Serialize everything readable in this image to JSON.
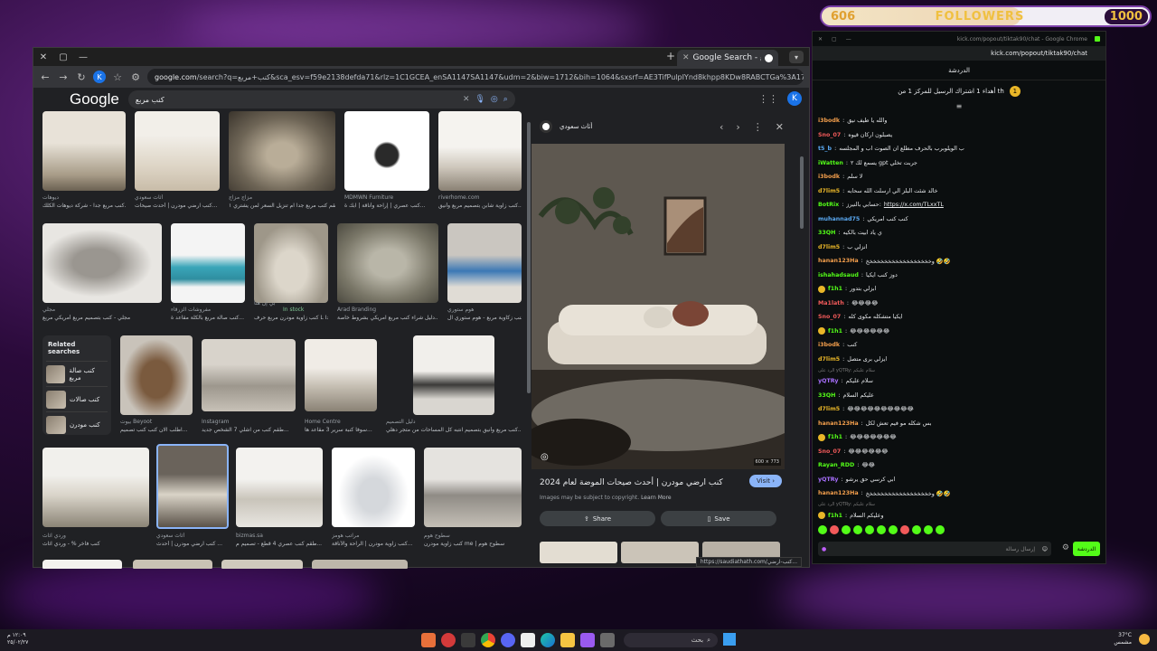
{
  "overlay": {
    "current_count": "606",
    "label": "FOLLOWERS",
    "goal": "1000",
    "progress_fraction": 0.606
  },
  "browser": {
    "tab_title": "Google Search - كنب مربع",
    "url_host": "google.com",
    "url_rest": "/search?q=كنب+مربع&sca_esv=f59e2138defda71&rlz=1C1GCEA_enSA1147SA1147&udm=2&biw=1712&bih=1064&sxsrf=AE3TifPulpIYnd8khpp8KDw8RABCTGa%3A1755712065658&ei=RfGmaK31J_qckdUP",
    "search_query": "كنب مربع",
    "avatar_letter": "K",
    "logo": "Google",
    "status_url": "https://saudiathath.com/كنب-ارضي..."
  },
  "results": {
    "row1": [
      {
        "source": "ديوهات",
        "title": "كنب مربع جدا - شركة ديوهات الكلك..."
      },
      {
        "source": "أثاث سعودي",
        "title": "كنب ارضي مودرن | أحدث صيحات..."
      },
      {
        "source": "مزاج مزاج",
        "title": "طقم كنب مربع جدا ام تنزيل السعر لمن يشتري ١..."
      },
      {
        "source": "MDMWN Furniture",
        "title": "كنب عصري | إراحة وأناقة | ابك ة..."
      },
      {
        "source": "riverhome.com",
        "title": "كنب زاوية شابن بتصميم مربع وأنيق..."
      }
    ],
    "row2": [
      {
        "source": "مجلي",
        "title": "مجلي - كنب بتصميم مربع أمريكي مربع"
      },
      {
        "source": "مفروشات الزرقاء",
        "title": "كنب صالة مربع بالكلة مقاعد ة..."
      },
      {
        "source": "بي إن هنا",
        "title": "كنب زاوية مودرن مربع حرف L جدا...",
        "stock": "In stock"
      },
      {
        "source": "Arad Branding",
        "title": "دليل شراء كنب مربع امريكي بشروط خاصة..."
      },
      {
        "source": "هوم ستوري",
        "title": "كنب زكاوية مربع - هوم ستوري ال..."
      }
    ],
    "related": {
      "heading": "Related searches",
      "items": [
        "كنب صالة مربع",
        "كنب صالات",
        "كنب مودرن"
      ]
    },
    "row3": [
      {
        "source": "بيوت Beyoot",
        "title": "اطلب الان كنب كنب تصميم..."
      },
      {
        "source": "Instagram",
        "title": "طقم كنب من آشلي 7 الشخص جديد..."
      },
      {
        "source": "Home Centre",
        "title": "سوفا كنبة سرير 3 مقاعد ها..."
      },
      {
        "source": "دليل التصميم",
        "title": "كنب مربع وأنيق بتصميم انتبه كل المساحات من متجر دهلي..."
      }
    ],
    "row4": [
      {
        "source": "وردي اثاث",
        "title": "كنب فاخر % - وردي اثاث"
      },
      {
        "source": "أثاث سعودي",
        "title": "كنب ارضي مودرن | أحدث ..."
      },
      {
        "source": "bizmas.sa",
        "title": "طقم كنب عصري 4 قطع - تصميم م..."
      },
      {
        "source": "مراتب هومز",
        "title": "كنب زاوية مودرن | الراحة والأناقة..."
      },
      {
        "source": "سطوح هوم",
        "title": "كنب زاوية مودرن me | سطوح هوم"
      }
    ]
  },
  "preview": {
    "source_name": "أثاث سعودي",
    "title": "كنب ارضي مودرن | أحدث صيحات الموضة لعام 2024",
    "visit_label": "Visit",
    "copyright": "Images may be subject to copyright.",
    "learn_more": "Learn More",
    "share_label": "Share",
    "save_label": "Save",
    "size": "600 × 773"
  },
  "chat": {
    "window_title": "kick.com/popout/tiktak90/chat - Google Chrome",
    "url": "kick.com/popout/tiktak90/chat",
    "header": "الدردشة",
    "pinned": "أهداء 1 اشتراك الرسيل للمركز 1 من th",
    "pinned_num": "1",
    "messages": [
      {
        "user": "i3bodk",
        "color": "#f29e4c",
        "text": "والله يا طيف نيق"
      },
      {
        "user": "Sno_07",
        "color": "#f25a5a",
        "text": "يصبلون اركان قيوه"
      },
      {
        "user": "t5_b",
        "color": "#5aa9f2",
        "text": "ب الويلوبرب بالحرف مطلع ان الصوت اب و المجلسه"
      },
      {
        "user": "iWatten",
        "color": "#53fc18",
        "text": "يسمع لك ٢ gpt جربت تخلي"
      },
      {
        "user": "i3bodk",
        "color": "#f29e4c",
        "text": "لا سلم"
      },
      {
        "user": "d7lim5",
        "color": "#e9b628",
        "text": "خالد شئت البلز الي ارسلت الله سحابه"
      },
      {
        "user": "BotRix",
        "color": "#53fc18",
        "text": "حسابي بالنيرز:",
        "link": "https://x.com/TLxxTL"
      },
      {
        "user": "muhannad75",
        "color": "#5aa9f2",
        "text": "كنب كنب امريكي"
      },
      {
        "user": "33QH",
        "color": "#53fc18",
        "text": "ي ياد ابيت بالكيه"
      },
      {
        "user": "d7lim5",
        "color": "#e9b628",
        "text": "انزلي ب"
      },
      {
        "user": "hanan123Ha",
        "color": "#f29e4c",
        "text": "وخخخخخخخخخخخخخخخخخخ 🤣🤣"
      },
      {
        "user": "ishahadsaud",
        "color": "#53fc18",
        "text": "دوز كنب ايكيا"
      },
      {
        "user": "f1h1",
        "color": "#53fc18",
        "text": "ابزلي بتدور"
      },
      {
        "user": "Ma1lath",
        "color": "#f25a5a",
        "text": "😂😂😂😂"
      },
      {
        "user": "Sno_07",
        "color": "#f25a5a",
        "text": "ايكيا متشكله مكوى كله"
      },
      {
        "user": "f1h1",
        "color": "#53fc18",
        "text": "😂😂😂😂😂😂"
      },
      {
        "user": "i3bodk",
        "color": "#f29e4c",
        "text": "كنب"
      },
      {
        "user": "d7lim5",
        "color": "#e9b628",
        "text": "ايزلي برى متصل"
      },
      {
        "user": "yQTRy",
        "color": "#a970ff",
        "text": "سلام عليكم",
        "reply": "الرد على yQTRy: سلام عليكم"
      },
      {
        "user": "33QH",
        "color": "#53fc18",
        "text": "عليكم السلام"
      },
      {
        "user": "d7lim5",
        "color": "#e9b628",
        "text": "😂😂😂😂😂😂😂😂😂😂"
      },
      {
        "user": "hanan123Ha",
        "color": "#f29e4c",
        "text": "بس شكله مو فيم تعش لكل"
      },
      {
        "user": "f1h1",
        "color": "#53fc18",
        "text": "😂😂😂😂😂😂😂"
      },
      {
        "user": "Sno_07",
        "color": "#f25a5a",
        "text": "😂😂😂😂😂😂"
      },
      {
        "user": "Rayan_RDD",
        "color": "#53fc18",
        "text": "😂😂"
      },
      {
        "user": "yQTRy",
        "color": "#a970ff",
        "text": "ابي كرسي حق يرشو"
      },
      {
        "user": "hanan123Ha",
        "color": "#f29e4c",
        "text": "وخخخخخخخخخخخخخخخخخخ 🤣🤣"
      },
      {
        "user": "f1h1",
        "color": "#53fc18",
        "text": "وعليكم السلام",
        "reply": "الرد على yQTRy: سلام عليكم"
      }
    ],
    "input_placeholder": "إرسال رسالة",
    "send_label": "الدردشة"
  },
  "taskbar": {
    "search_label": "بحث",
    "time": "١٢:٠٩ م",
    "date": "٢٥/٠٢/٢٧",
    "temp": "37°C",
    "weather": "مشمس"
  },
  "colors": {
    "chrome_bg": "#202124",
    "kick_green": "#53fc18",
    "google_blue": "#8ab4f8"
  }
}
